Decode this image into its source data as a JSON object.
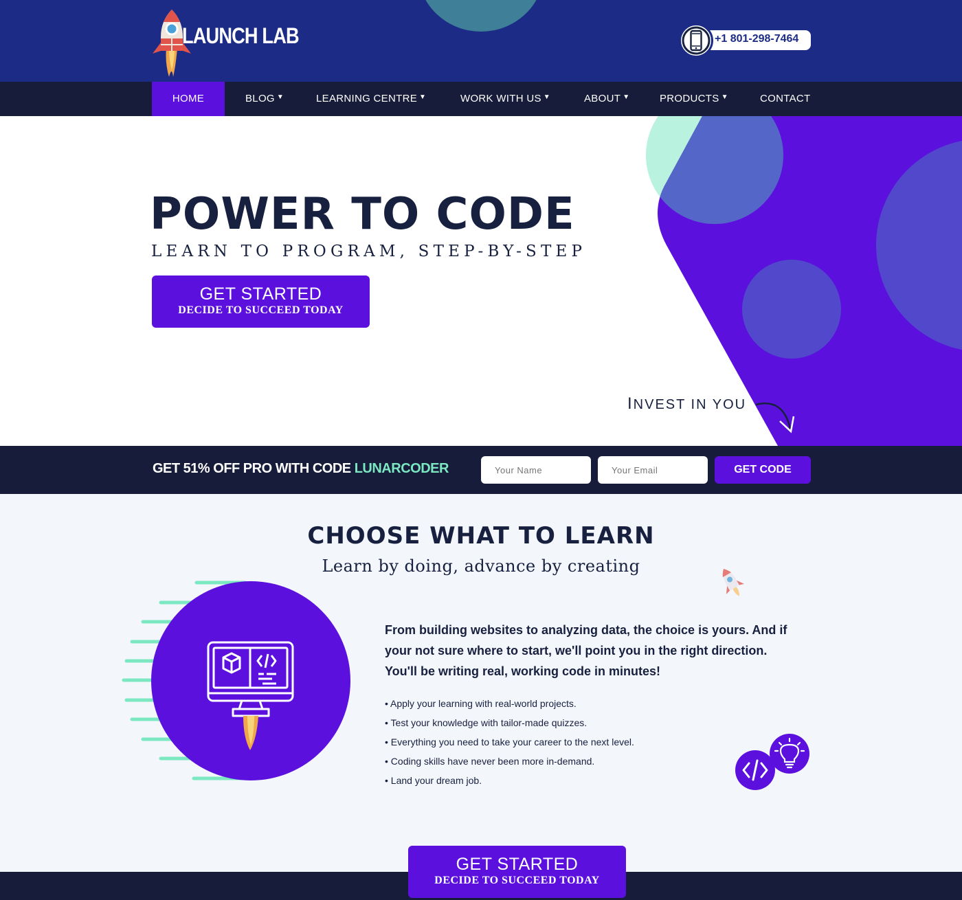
{
  "header": {
    "logo_text": "LAUNCH LAB",
    "phone": "+1 801-298-7464"
  },
  "nav": {
    "items": [
      {
        "label": "HOME",
        "dropdown": false,
        "active": true
      },
      {
        "label": "BLOG",
        "dropdown": true
      },
      {
        "label": "LEARNING CENTRE",
        "dropdown": true
      },
      {
        "label": "WORK WITH US",
        "dropdown": true
      },
      {
        "label": "ABOUT",
        "dropdown": true
      },
      {
        "label": "PRODUCTS",
        "dropdown": true
      },
      {
        "label": "CONTACT",
        "dropdown": false
      }
    ],
    "caret": "▼"
  },
  "hero": {
    "title": "POWER TO CODE",
    "subtitle": "LEARN TO PROGRAM, STEP-BY-STEP",
    "cta_main": "GET STARTED",
    "cta_sub": "DECIDE TO SUCCEED TODAY",
    "invest_first": "I",
    "invest_rest": "NVEST IN YOU"
  },
  "promo": {
    "text": "GET 51% OFF PRO WITH CODE ",
    "code": "LUNARCODER",
    "name_placeholder": "Your Name",
    "email_placeholder": "Your Email",
    "button": "GET CODE"
  },
  "learn": {
    "title": "CHOOSE WHAT TO LEARN",
    "subtitle": "Learn by doing, advance by creating",
    "intro": "From building websites to analyzing data, the choice is yours. And if your not sure where to start, we'll point you in the right direction. You'll be writing real, working code in minutes!",
    "bullets": [
      "• Apply your learning with real-world projects.",
      "• Test your knowledge with tailor-made quizzes.",
      "• Everything you need to take your career to the next level.",
      "• Coding skills have never been more in-demand.",
      "• Land your dream job."
    ],
    "cta_main": "GET STARTED",
    "cta_sub": "DECIDE TO SUCCEED TODAY"
  },
  "colors": {
    "header_bg": "#1c2b85",
    "nav_bg": "#161c3a",
    "accent_purple": "#5c10de",
    "mint": "#7ce8c2",
    "dark_text": "#17203f"
  },
  "icons": [
    "rocket-icon",
    "smartphone-icon",
    "monitor-code-icon",
    "code-icon",
    "lightbulb-icon",
    "arrow-icon"
  ]
}
